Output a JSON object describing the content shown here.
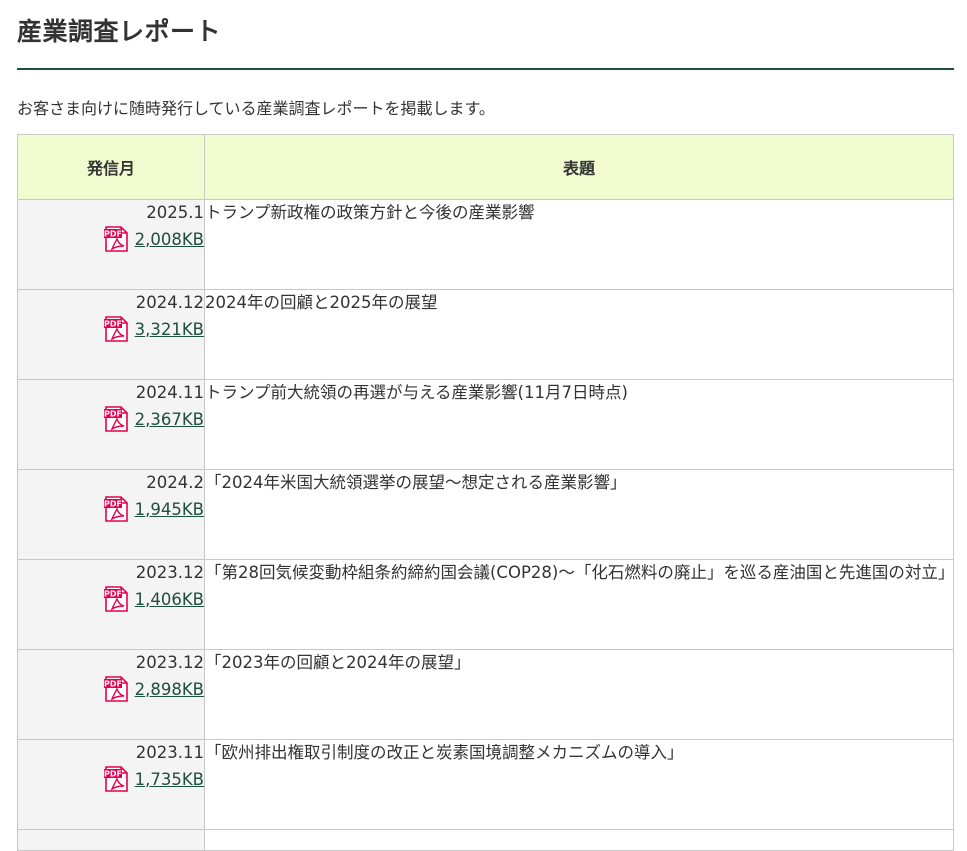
{
  "page": {
    "title": "産業調査レポート",
    "intro": "お客さま向けに随時発行している産業調査レポートを掲載します。"
  },
  "table": {
    "headers": {
      "date": "発信月",
      "title": "表題"
    },
    "rows": [
      {
        "date": "2025.1",
        "size": "2,008KB",
        "title": "トランプ新政権の政策方針と今後の産業影響"
      },
      {
        "date": "2024.12",
        "size": "3,321KB",
        "title": "2024年の回顧と2025年の展望"
      },
      {
        "date": "2024.11",
        "size": "2,367KB",
        "title": "トランプ前大統領の再選が与える産業影響(11月7日時点)"
      },
      {
        "date": "2024.2",
        "size": "1,945KB",
        "title": "「2024年米国大統領選挙の展望～想定される産業影響」"
      },
      {
        "date": "2023.12",
        "size": "1,406KB",
        "title": "「第28回気候変動枠組条約締約国会議(COP28)～「化石燃料の廃止」を巡る産油国と先進国の対立」"
      },
      {
        "date": "2023.12",
        "size": "2,898KB",
        "title": "「2023年の回顧と2024年の展望」"
      },
      {
        "date": "2023.11",
        "size": "1,735KB",
        "title": "「欧州排出権取引制度の改正と炭素国境調整メカニズムの導入」"
      }
    ],
    "file_icon": "pdf-file-icon"
  },
  "colors": {
    "accent": "#1e4f3f",
    "header_bg": "#f0fbd0",
    "date_bg": "#f4f4f4",
    "pdf_red": "#e6004c"
  }
}
